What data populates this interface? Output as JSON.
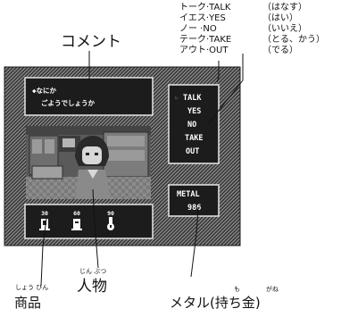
{
  "command_legend": [
    {
      "term": "トーク·TALK",
      "reading": "（はなす）"
    },
    {
      "term": "イエス·YES",
      "reading": "（はい）"
    },
    {
      "term": "ノー ·NO",
      "reading": "（いいえ）"
    },
    {
      "term": "テーク·TAKE",
      "reading": "（とる、かう）"
    },
    {
      "term": "アウト·OUT",
      "reading": "（でる）"
    }
  ],
  "callouts": {
    "comment": "コメント",
    "person": "人物",
    "person_ruby": "じん ぶつ",
    "goods": "商品",
    "goods_ruby": "しょう ひん",
    "metal_prefix": "メタル(",
    "metal_kanji1": "持",
    "metal_mid": "ち",
    "metal_kanji2": "金",
    "metal_suffix": ")",
    "metal_ruby1": "も",
    "metal_ruby2": "がね"
  },
  "game_screen": {
    "dialog_speaker": "◆なにか",
    "dialog_text": "ごようでしょうか",
    "commands": [
      "TALK",
      "YES",
      "NO",
      "TAKE",
      "OUT"
    ],
    "cursor": "☞",
    "metal_label": "METAL",
    "metal_value": "986",
    "shelf_prices": [
      "30",
      "60",
      "90"
    ]
  },
  "colors": {
    "screen_frame": "#2e2e2e",
    "hatch": "#8a8a8a",
    "panel": "#1c1c1c",
    "scene": "#6d6d6d",
    "text_light": "#ffffff"
  }
}
